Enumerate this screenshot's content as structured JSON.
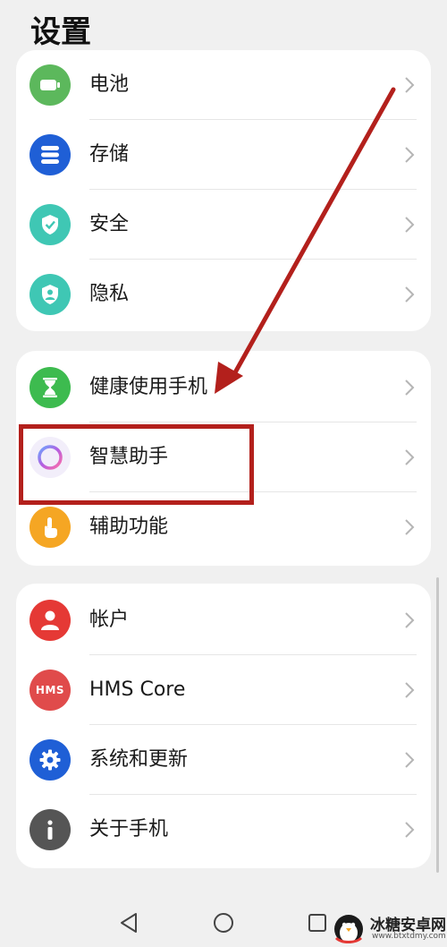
{
  "header": {
    "title": "设置"
  },
  "groups": [
    {
      "items": [
        {
          "label": "电池",
          "icon": "battery-icon",
          "color": "#5cb85c"
        },
        {
          "label": "存储",
          "icon": "storage-icon",
          "color": "#1f5fd6"
        },
        {
          "label": "安全",
          "icon": "shield-icon",
          "color": "#3fc7b4"
        },
        {
          "label": "隐私",
          "icon": "privacy-shield-icon",
          "color": "#3fc7b4"
        }
      ]
    },
    {
      "items": [
        {
          "label": "健康使用手机",
          "icon": "hourglass-icon",
          "color": "#3dbb4f"
        },
        {
          "label": "智慧助手",
          "icon": "assistant-ring-icon",
          "color": "#b45de0"
        },
        {
          "label": "辅助功能",
          "icon": "hand-pointer-icon",
          "color": "#f5a623"
        }
      ]
    },
    {
      "items": [
        {
          "label": "帐户",
          "icon": "user-icon",
          "color": "#e53935"
        },
        {
          "label": "HMS Core",
          "icon": "hms-icon",
          "icon_text": "HMS",
          "color": "#e04b4b"
        },
        {
          "label": "系统和更新",
          "icon": "gear-icon",
          "color": "#1f5fd6"
        },
        {
          "label": "关于手机",
          "icon": "info-icon",
          "color": "#555555"
        }
      ]
    }
  ],
  "navbar": {
    "back": "back-icon",
    "home": "home-icon",
    "recents": "recents-icon"
  },
  "annotation": {
    "color": "#b3201c"
  },
  "watermark": {
    "name": "冰糖安卓网",
    "url": "www.btxtdmy.com"
  }
}
